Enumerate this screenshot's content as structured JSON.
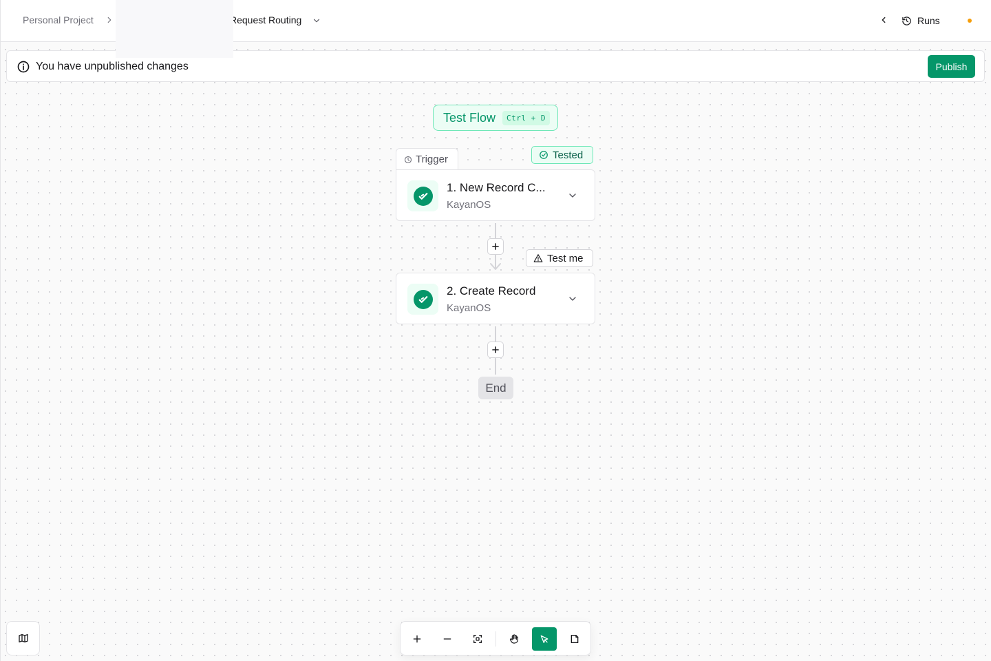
{
  "header": {
    "breadcrumb_root": "Personal Project",
    "flow_name": "Request Routing",
    "runs_label": "Runs"
  },
  "banner": {
    "message": "You have unpublished changes",
    "publish_label": "Publish"
  },
  "test_flow": {
    "label": "Test Flow",
    "shortcut": "Ctrl + D"
  },
  "steps": [
    {
      "tab_label": "Trigger",
      "status": "Tested",
      "title": "1. New Record C...",
      "app": "KayanOS"
    },
    {
      "status": "Test me",
      "title": "2. Create Record",
      "app": "KayanOS"
    }
  ],
  "end_label": "End",
  "colors": {
    "accent": "#059669",
    "accent_light": "#ecfdf5",
    "warning_dot": "#f59e0b"
  },
  "icons": {
    "step_app": "check-swoosh-icon",
    "banner": "info-icon",
    "toolbar": [
      "zoom-in-icon",
      "zoom-out-icon",
      "fit-view-icon",
      "hand-icon",
      "pointer-icon",
      "note-icon"
    ]
  }
}
